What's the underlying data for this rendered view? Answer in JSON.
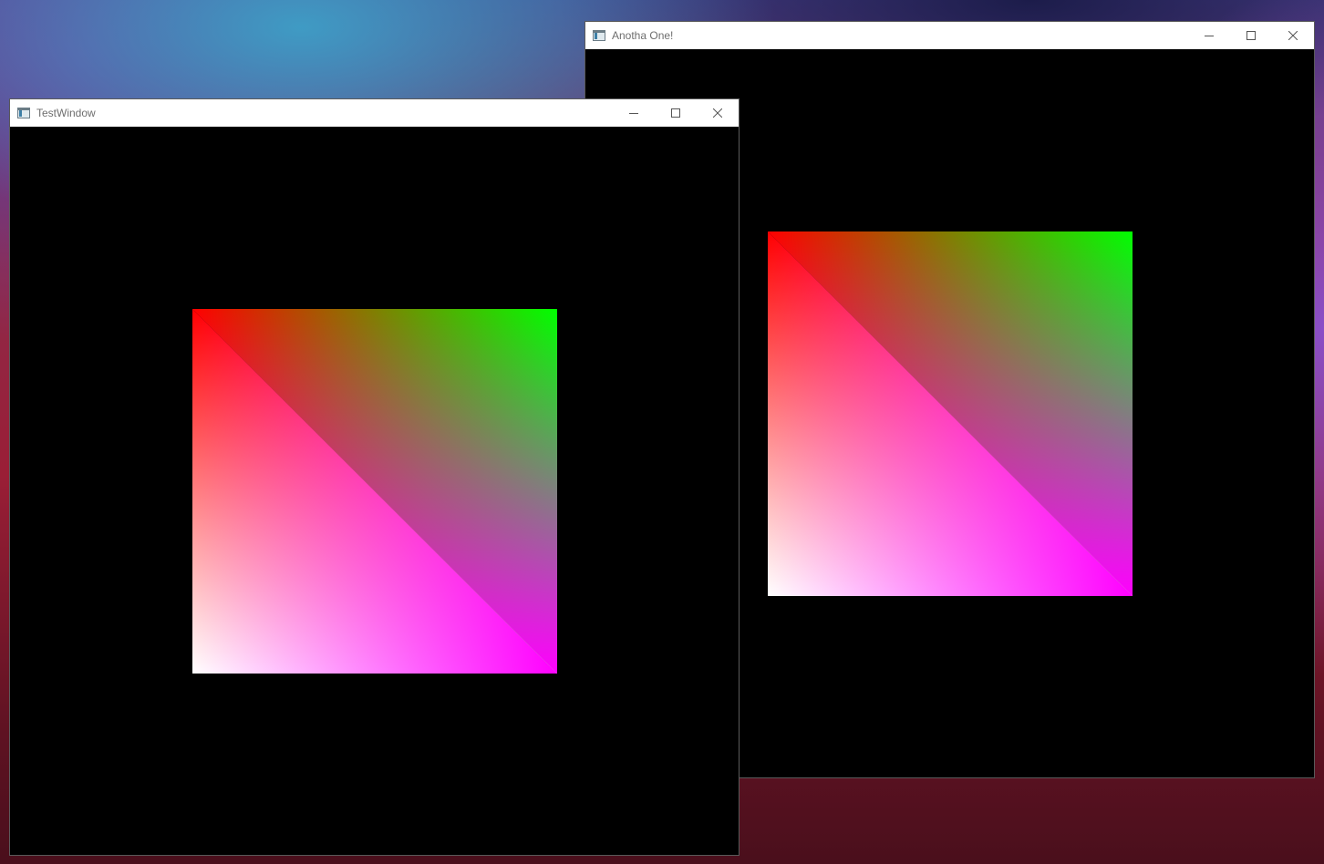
{
  "windows": [
    {
      "id": "test-window",
      "title": "TestWindow",
      "controls": [
        "minimize-icon",
        "maximize-icon",
        "close-icon"
      ]
    },
    {
      "id": "anotha-one",
      "title": "Anotha One!",
      "controls": [
        "minimize-icon",
        "maximize-icon",
        "close-icon"
      ]
    }
  ],
  "colors": {
    "top_left": "#ff0000",
    "top_right": "#00ff00",
    "bottom_left": "#ffffff",
    "bottom_right": "#ff00ff",
    "clear": "#000000"
  }
}
